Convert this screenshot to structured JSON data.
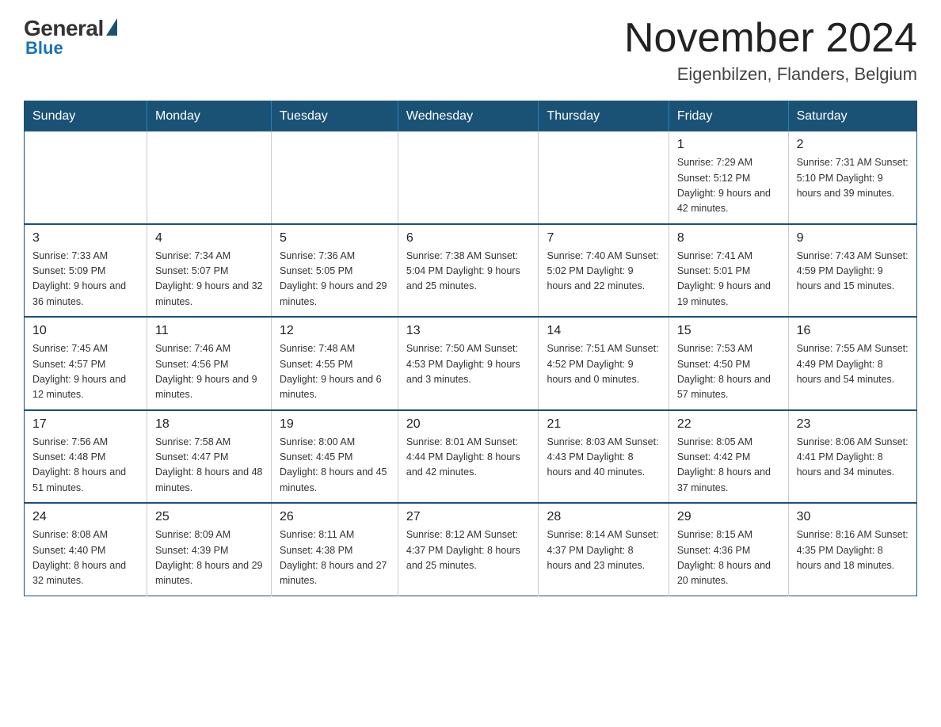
{
  "logo": {
    "general": "General",
    "blue": "Blue"
  },
  "title": "November 2024",
  "location": "Eigenbilzen, Flanders, Belgium",
  "days_of_week": [
    "Sunday",
    "Monday",
    "Tuesday",
    "Wednesday",
    "Thursday",
    "Friday",
    "Saturday"
  ],
  "weeks": [
    [
      {
        "day": "",
        "info": ""
      },
      {
        "day": "",
        "info": ""
      },
      {
        "day": "",
        "info": ""
      },
      {
        "day": "",
        "info": ""
      },
      {
        "day": "",
        "info": ""
      },
      {
        "day": "1",
        "info": "Sunrise: 7:29 AM\nSunset: 5:12 PM\nDaylight: 9 hours\nand 42 minutes."
      },
      {
        "day": "2",
        "info": "Sunrise: 7:31 AM\nSunset: 5:10 PM\nDaylight: 9 hours\nand 39 minutes."
      }
    ],
    [
      {
        "day": "3",
        "info": "Sunrise: 7:33 AM\nSunset: 5:09 PM\nDaylight: 9 hours\nand 36 minutes."
      },
      {
        "day": "4",
        "info": "Sunrise: 7:34 AM\nSunset: 5:07 PM\nDaylight: 9 hours\nand 32 minutes."
      },
      {
        "day": "5",
        "info": "Sunrise: 7:36 AM\nSunset: 5:05 PM\nDaylight: 9 hours\nand 29 minutes."
      },
      {
        "day": "6",
        "info": "Sunrise: 7:38 AM\nSunset: 5:04 PM\nDaylight: 9 hours\nand 25 minutes."
      },
      {
        "day": "7",
        "info": "Sunrise: 7:40 AM\nSunset: 5:02 PM\nDaylight: 9 hours\nand 22 minutes."
      },
      {
        "day": "8",
        "info": "Sunrise: 7:41 AM\nSunset: 5:01 PM\nDaylight: 9 hours\nand 19 minutes."
      },
      {
        "day": "9",
        "info": "Sunrise: 7:43 AM\nSunset: 4:59 PM\nDaylight: 9 hours\nand 15 minutes."
      }
    ],
    [
      {
        "day": "10",
        "info": "Sunrise: 7:45 AM\nSunset: 4:57 PM\nDaylight: 9 hours\nand 12 minutes."
      },
      {
        "day": "11",
        "info": "Sunrise: 7:46 AM\nSunset: 4:56 PM\nDaylight: 9 hours\nand 9 minutes."
      },
      {
        "day": "12",
        "info": "Sunrise: 7:48 AM\nSunset: 4:55 PM\nDaylight: 9 hours\nand 6 minutes."
      },
      {
        "day": "13",
        "info": "Sunrise: 7:50 AM\nSunset: 4:53 PM\nDaylight: 9 hours\nand 3 minutes."
      },
      {
        "day": "14",
        "info": "Sunrise: 7:51 AM\nSunset: 4:52 PM\nDaylight: 9 hours\nand 0 minutes."
      },
      {
        "day": "15",
        "info": "Sunrise: 7:53 AM\nSunset: 4:50 PM\nDaylight: 8 hours\nand 57 minutes."
      },
      {
        "day": "16",
        "info": "Sunrise: 7:55 AM\nSunset: 4:49 PM\nDaylight: 8 hours\nand 54 minutes."
      }
    ],
    [
      {
        "day": "17",
        "info": "Sunrise: 7:56 AM\nSunset: 4:48 PM\nDaylight: 8 hours\nand 51 minutes."
      },
      {
        "day": "18",
        "info": "Sunrise: 7:58 AM\nSunset: 4:47 PM\nDaylight: 8 hours\nand 48 minutes."
      },
      {
        "day": "19",
        "info": "Sunrise: 8:00 AM\nSunset: 4:45 PM\nDaylight: 8 hours\nand 45 minutes."
      },
      {
        "day": "20",
        "info": "Sunrise: 8:01 AM\nSunset: 4:44 PM\nDaylight: 8 hours\nand 42 minutes."
      },
      {
        "day": "21",
        "info": "Sunrise: 8:03 AM\nSunset: 4:43 PM\nDaylight: 8 hours\nand 40 minutes."
      },
      {
        "day": "22",
        "info": "Sunrise: 8:05 AM\nSunset: 4:42 PM\nDaylight: 8 hours\nand 37 minutes."
      },
      {
        "day": "23",
        "info": "Sunrise: 8:06 AM\nSunset: 4:41 PM\nDaylight: 8 hours\nand 34 minutes."
      }
    ],
    [
      {
        "day": "24",
        "info": "Sunrise: 8:08 AM\nSunset: 4:40 PM\nDaylight: 8 hours\nand 32 minutes."
      },
      {
        "day": "25",
        "info": "Sunrise: 8:09 AM\nSunset: 4:39 PM\nDaylight: 8 hours\nand 29 minutes."
      },
      {
        "day": "26",
        "info": "Sunrise: 8:11 AM\nSunset: 4:38 PM\nDaylight: 8 hours\nand 27 minutes."
      },
      {
        "day": "27",
        "info": "Sunrise: 8:12 AM\nSunset: 4:37 PM\nDaylight: 8 hours\nand 25 minutes."
      },
      {
        "day": "28",
        "info": "Sunrise: 8:14 AM\nSunset: 4:37 PM\nDaylight: 8 hours\nand 23 minutes."
      },
      {
        "day": "29",
        "info": "Sunrise: 8:15 AM\nSunset: 4:36 PM\nDaylight: 8 hours\nand 20 minutes."
      },
      {
        "day": "30",
        "info": "Sunrise: 8:16 AM\nSunset: 4:35 PM\nDaylight: 8 hours\nand 18 minutes."
      }
    ]
  ]
}
